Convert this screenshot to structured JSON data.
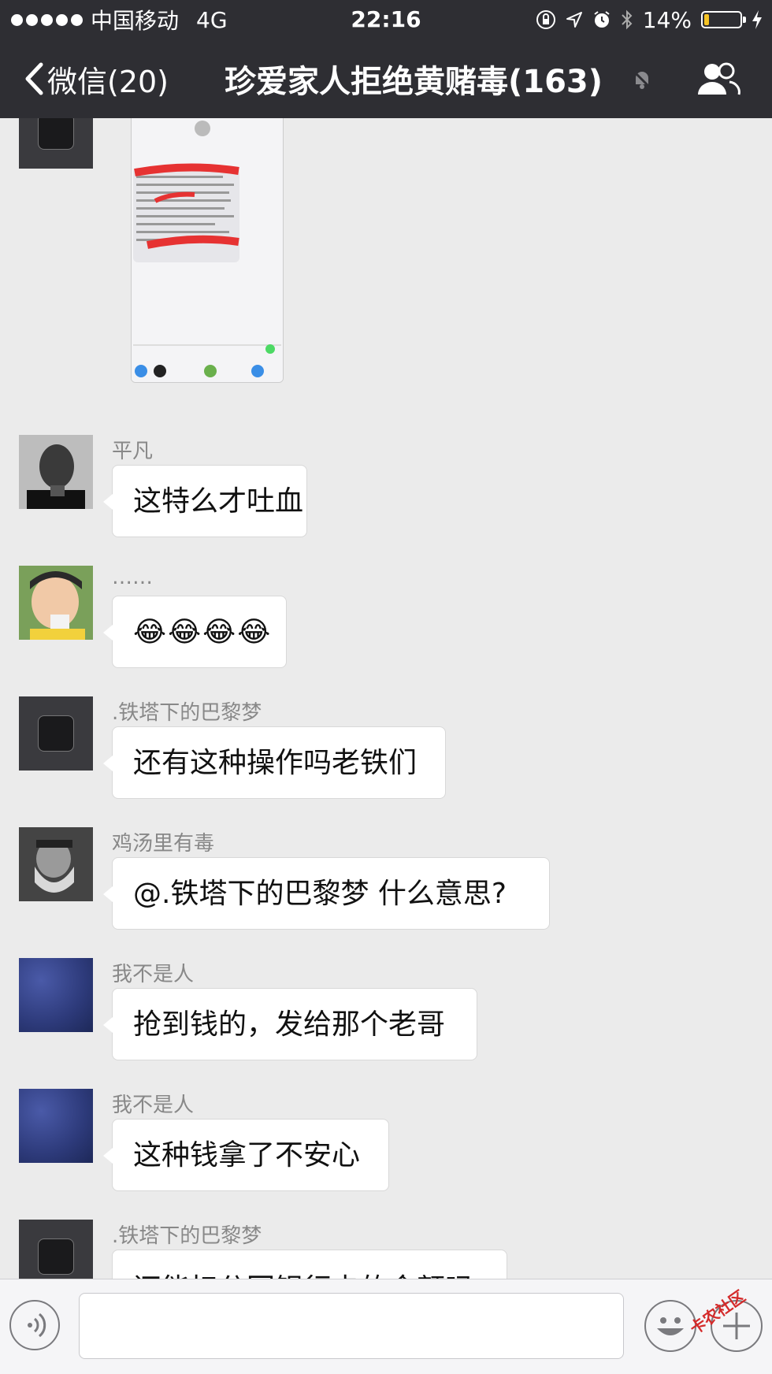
{
  "status_bar": {
    "carrier": "中国移动",
    "network": "4G",
    "time": "22:16",
    "battery": "14%",
    "battery_level": 0.14
  },
  "nav": {
    "back_label": "微信(20)",
    "title": "珍爱家人拒绝黄赌毒(163)"
  },
  "messages": [
    {
      "sender": "平凡",
      "text": "这特么才吐血"
    },
    {
      "sender": "……",
      "text": "😂😂😂😂"
    },
    {
      "sender": ".铁塔下的巴黎梦",
      "text": "还有这种操作吗老铁们"
    },
    {
      "sender": "鸡汤里有毒",
      "text": "@.铁塔下的巴黎梦 什么意思?"
    },
    {
      "sender": "我不是人",
      "text": "抢到钱的，发给那个老哥"
    },
    {
      "sender": "我不是人",
      "text": "这种钱拿了不安心"
    },
    {
      "sender": ".铁塔下的巴黎梦",
      "text": "还能扣分回银行卡的金额吗"
    }
  ],
  "watermark": "卡农社区",
  "colors": {
    "header_bg": "#2e2e33",
    "chat_bg": "#ebebeb",
    "battery_fill": "#f5c325"
  }
}
